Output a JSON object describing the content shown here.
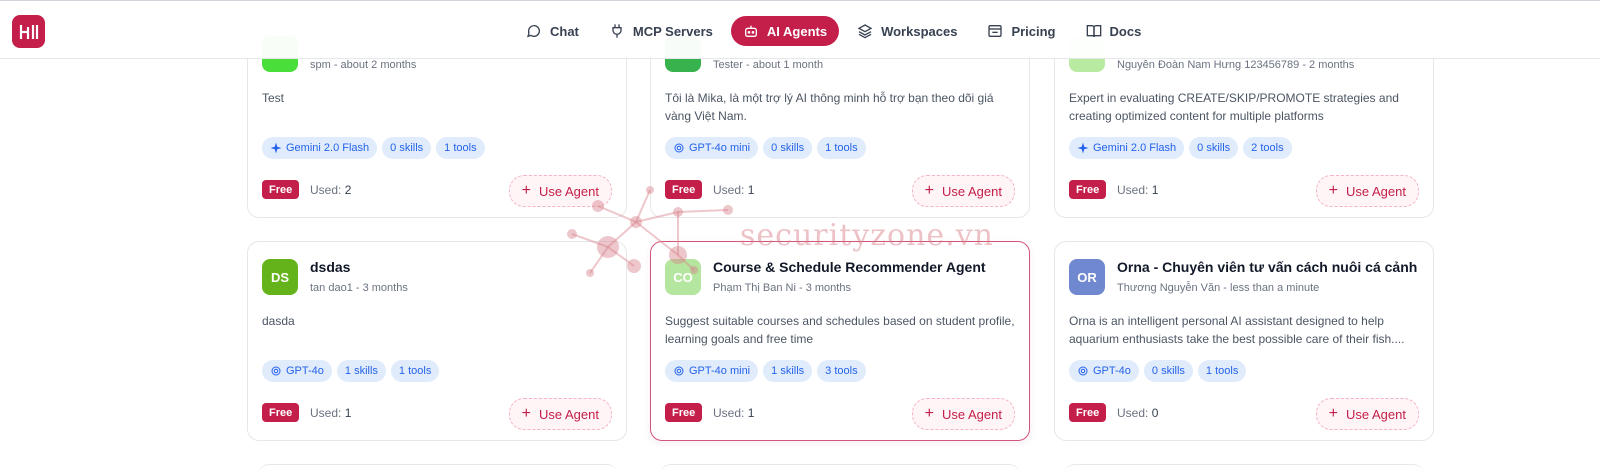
{
  "header": {
    "logo_alt": "HI logo",
    "nav": [
      {
        "label": "Chat",
        "icon": "chat-bubble-icon",
        "active": false
      },
      {
        "label": "MCP Servers",
        "icon": "plug-icon",
        "active": false
      },
      {
        "label": "AI Agents",
        "icon": "robot-icon",
        "active": true
      },
      {
        "label": "Workspaces",
        "icon": "layers-icon",
        "active": false
      },
      {
        "label": "Pricing",
        "icon": "pricing-icon",
        "active": false
      },
      {
        "label": "Docs",
        "icon": "book-icon",
        "active": false
      }
    ]
  },
  "use_agent_label": "Use Agent",
  "free_label": "Free",
  "used_label": "Used:",
  "cards": [
    {
      "initials": "",
      "avatar_color": "#4ade3b",
      "title": "",
      "meta": "spm - about 2 months",
      "description": "Test",
      "chips": [
        {
          "label": "Gemini 2.0 Flash",
          "icon": "sparkle-icon"
        },
        {
          "label": "0 skills",
          "icon": ""
        },
        {
          "label": "1 tools",
          "icon": ""
        }
      ],
      "used": "2"
    },
    {
      "initials": "",
      "avatar_color": "#37b24d",
      "title": "",
      "meta": "Tester - about 1 month",
      "description": "Tôi là Mika, là một trợ lý AI thông minh hỗ trợ bạn theo dõi giá vàng Việt Nam.",
      "chips": [
        {
          "label": "GPT-4o mini",
          "icon": "openai-icon"
        },
        {
          "label": "0 skills",
          "icon": ""
        },
        {
          "label": "1 tools",
          "icon": ""
        }
      ],
      "used": "1"
    },
    {
      "initials": "",
      "avatar_color": "#b8eaa2",
      "title": "",
      "meta": "Nguyễn Đoàn Nam Hưng 123456789 - 2 months",
      "description": "Expert in evaluating CREATE/SKIP/PROMOTE strategies and creating optimized content for multiple platforms",
      "chips": [
        {
          "label": "Gemini 2.0 Flash",
          "icon": "sparkle-icon"
        },
        {
          "label": "0 skills",
          "icon": ""
        },
        {
          "label": "2 tools",
          "icon": ""
        }
      ],
      "used": "1"
    },
    {
      "initials": "DS",
      "avatar_color": "#65b31a",
      "title": "dsdas",
      "meta": "tan dao1 - 3 months",
      "description": "dasda",
      "chips": [
        {
          "label": "GPT-4o",
          "icon": "openai-icon"
        },
        {
          "label": "1 skills",
          "icon": ""
        },
        {
          "label": "1 tools",
          "icon": ""
        }
      ],
      "used": "1"
    },
    {
      "initials": "CO",
      "avatar_color": "#b5e6a0",
      "title": "Course & Schedule Recommender Agent",
      "meta": "Phạm Thị Ban Ni - 3 months",
      "description": "Suggest suitable courses and schedules based on student profile, learning goals and free time",
      "chips": [
        {
          "label": "GPT-4o mini",
          "icon": "openai-icon"
        },
        {
          "label": "1 skills",
          "icon": ""
        },
        {
          "label": "3 tools",
          "icon": ""
        }
      ],
      "used": "1"
    },
    {
      "initials": "OR",
      "avatar_color": "#7088cf",
      "title": "Orna - Chuyên viên tư vấn cách nuôi cá cảnh",
      "meta": "Thương Nguyễn Văn - less than a minute",
      "description": "Orna is an intelligent personal AI assistant designed to help aquarium enthusiasts take the best possible care of their fish....",
      "chips": [
        {
          "label": "GPT-4o",
          "icon": "openai-icon"
        },
        {
          "label": "0 skills",
          "icon": ""
        },
        {
          "label": "1 tools",
          "icon": ""
        }
      ],
      "used": "0"
    }
  ],
  "watermark_text": "securityzone.vn"
}
